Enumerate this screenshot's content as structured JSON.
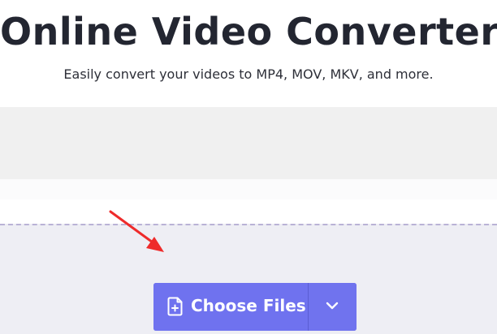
{
  "header": {
    "title": "Online Video Converter",
    "subtitle": "Easily convert your videos to MP4, MOV, MKV, and more."
  },
  "upload": {
    "choose_files_label": "Choose Files",
    "file_icon": "file-plus-icon",
    "dropdown_icon": "chevron-down-icon"
  },
  "annotation": {
    "arrow_icon": "red-pointer-arrow",
    "color": "#ee2b2b"
  },
  "colors": {
    "accent": "#6f72ef",
    "title": "#232631",
    "drop_zone_bg": "#eeeef4",
    "drop_zone_border": "#b9b2d6"
  }
}
